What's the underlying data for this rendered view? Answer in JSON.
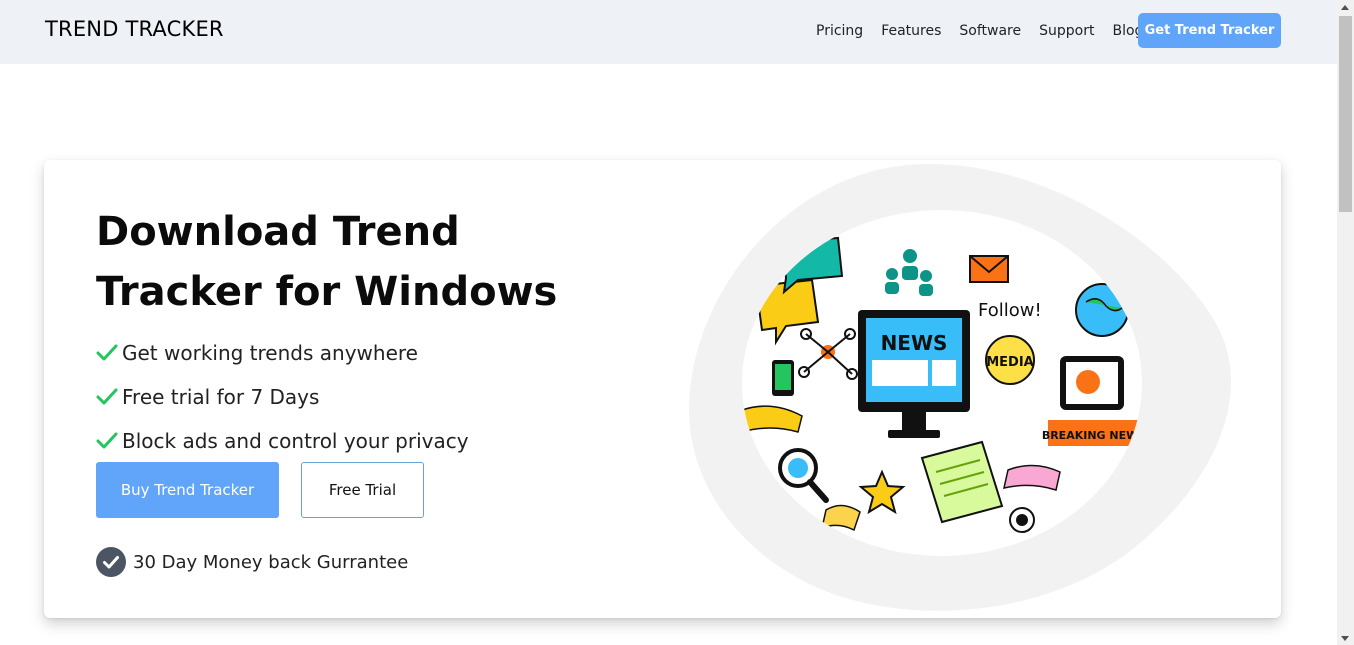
{
  "header": {
    "brand": "TREND TRACKER",
    "nav": [
      "Pricing",
      "Features",
      "Software",
      "Support",
      "Blog"
    ],
    "cta_label": "Get Trend Tracker"
  },
  "hero": {
    "title": "Download Trend Tracker for Windows",
    "features": [
      "Get working trends anywhere",
      "Free trial for 7 Days",
      "Block ads and control your privacy"
    ],
    "buy_label": "Buy Trend Tracker",
    "trial_label": "Free Trial",
    "guarantee": "30 Day Money back Gurrantee",
    "illustration": {
      "monitor_text": "NEWS",
      "badge_text": "MEDIA",
      "follow_text": "Follow!",
      "banner_text": "BREAKING NEWS"
    }
  },
  "colors": {
    "accent": "#60a5fa",
    "check": "#22c55e",
    "nav_bg": "#eef2f7",
    "guarantee_badge": "#4b5563"
  }
}
